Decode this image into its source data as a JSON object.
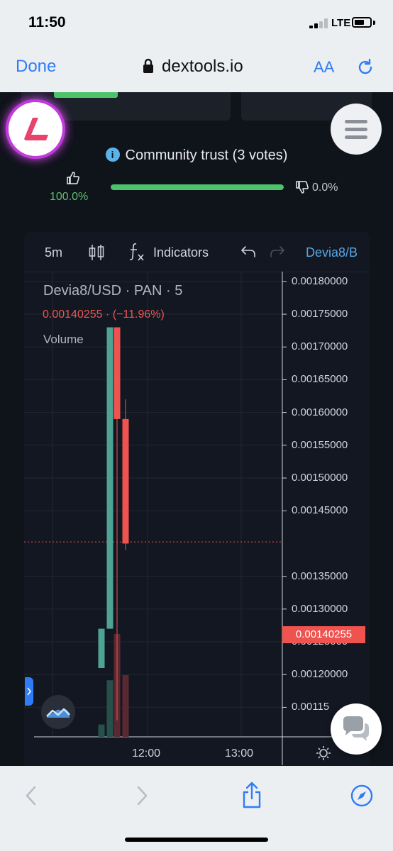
{
  "status_bar": {
    "time": "11:50",
    "network": "LTE",
    "icons": [
      "signal-icon",
      "battery-icon"
    ]
  },
  "browser": {
    "done_label": "Done",
    "url": "dextools.io",
    "text_size_label": "AA",
    "icons": [
      "lock-icon",
      "reload-icon"
    ]
  },
  "trust": {
    "title": "Community trust (3 votes)",
    "up_percent": "100.0%",
    "down_percent": "0.0%",
    "up_fraction": 1.0,
    "colors": {
      "up": "#4ec26b",
      "down": "#c3c6cc"
    }
  },
  "chart_toolbar": {
    "interval": "5m",
    "indicators_label": "Indicators",
    "symbol": "Devia8/B",
    "icons": [
      "candlestick-icon",
      "fx-icon",
      "undo-icon",
      "redo-icon"
    ]
  },
  "chart_data": {
    "type": "candlestick",
    "legend_title": "Devia8/USD · PAN · 5",
    "legend_price": "0.00140255 · (−11.96%)",
    "volume_label": "Volume",
    "last_price_tag": "0.00140255",
    "last_price": 0.00140255,
    "y_ticks": [
      "0.00180000",
      "0.00175000",
      "0.00170000",
      "0.00165000",
      "0.00160000",
      "0.00155000",
      "0.00150000",
      "0.00145000",
      "0.00135000",
      "0.00130000",
      "0.00125000",
      "0.00120000",
      "0.00115"
    ],
    "y_range": [
      0.001105,
      0.001815
    ],
    "x_ticks": [
      "12:00",
      "13:00"
    ],
    "candles": [
      {
        "open": 0.00121,
        "high": 0.00127,
        "low": 0.00121,
        "close": 0.00127,
        "volume": 0.12,
        "up": true
      },
      {
        "open": 0.00127,
        "high": 0.00173,
        "low": 0.00127,
        "close": 0.00173,
        "volume": 0.55,
        "up": true
      },
      {
        "open": 0.00173,
        "high": 0.00173,
        "low": 0.00113,
        "close": 0.00159,
        "volume": 1.0,
        "up": false
      },
      {
        "open": 0.00159,
        "high": 0.00162,
        "low": 0.00139,
        "close": 0.0014,
        "volume": 0.6,
        "up": false
      }
    ],
    "colors": {
      "up": "#4ea394",
      "down": "#ef5350",
      "grid": "#232732",
      "volume_up": "#26514b",
      "volume_down": "#5a2830"
    }
  }
}
